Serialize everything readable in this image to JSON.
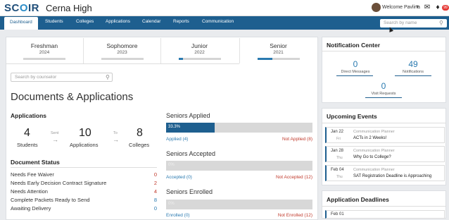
{
  "topbar": {
    "logo_a": "SC",
    "logo_o": "O",
    "logo_b": "IR",
    "school": "Cerna High",
    "welcome": "Welcome Pavlina",
    "badge": "99"
  },
  "nav": {
    "tabs": [
      "Dashboard",
      "Students",
      "Colleges",
      "Applications",
      "Calendar",
      "Reports",
      "Communication"
    ],
    "search_placeholder": "Search by name"
  },
  "grades": [
    {
      "name": "Freshman",
      "year": "2024",
      "progress": 0
    },
    {
      "name": "Sophomore",
      "year": "2023",
      "progress": 0
    },
    {
      "name": "Junior",
      "year": "2022",
      "progress": 0.1
    },
    {
      "name": "Senior",
      "year": "2021",
      "progress": 0.35
    }
  ],
  "counselor_search_placeholder": "Search by counselor",
  "main_title": "Documents & Applications",
  "applications": {
    "heading": "Applications",
    "students_num": "4",
    "students_label": "Students",
    "sent_label": "Sent",
    "apps_num": "10",
    "apps_label": "Applications",
    "to_label": "To",
    "colleges_num": "8",
    "colleges_label": "Colleges"
  },
  "document_status": {
    "heading": "Document Status",
    "items": [
      {
        "label": "Needs Fee Waiver",
        "value": "0",
        "color": "#c0392b"
      },
      {
        "label": "Needs Early Decision Contract Signature",
        "value": "2",
        "color": "#c0392b"
      },
      {
        "label": "Needs Attention",
        "value": "4",
        "color": "#c0392b"
      },
      {
        "label": "Complete Packets Ready to Send",
        "value": "8",
        "color": "#2a7ab0"
      },
      {
        "label": "Awaiting Delivery",
        "value": "0",
        "color": "#2a7ab0"
      }
    ]
  },
  "seniors": {
    "applied": {
      "title": "Seniors Applied",
      "percent_label": "33.3%",
      "progress": 0.333,
      "left": "Applied (4)",
      "right": "Not Applied (8)"
    },
    "accepted": {
      "title": "Seniors Accepted",
      "percent_label": "0%",
      "progress": 0,
      "left": "Accepted (0)",
      "right": "Not Accepted (12)"
    },
    "enrolled": {
      "title": "Seniors Enrolled",
      "percent_label": "0%",
      "progress": 0,
      "left": "Enrolled (0)",
      "right": "Not Enrolled (12)"
    }
  },
  "notifications": {
    "title": "Notification Center",
    "direct_num": "0",
    "direct_label": "Direct Messages",
    "notif_num": "49",
    "notif_label": "Notifications",
    "visit_num": "0",
    "visit_label": "Visit Requests"
  },
  "events": {
    "title": "Upcoming Events",
    "items": [
      {
        "date": "Jan 22",
        "weekday": "Fri",
        "category": "Communication Planner",
        "name": "ACTs in 2 Weeks!"
      },
      {
        "date": "Jan 28",
        "weekday": "Thu",
        "category": "Communication Planner",
        "name": "Why Go to College?"
      },
      {
        "date": "Feb 04",
        "weekday": "Thu",
        "category": "Communication Planner",
        "name": "SAT Registration Deadline is Approaching"
      }
    ]
  },
  "deadlines": {
    "title": "Application Deadlines",
    "first_date": "Feb 01"
  }
}
